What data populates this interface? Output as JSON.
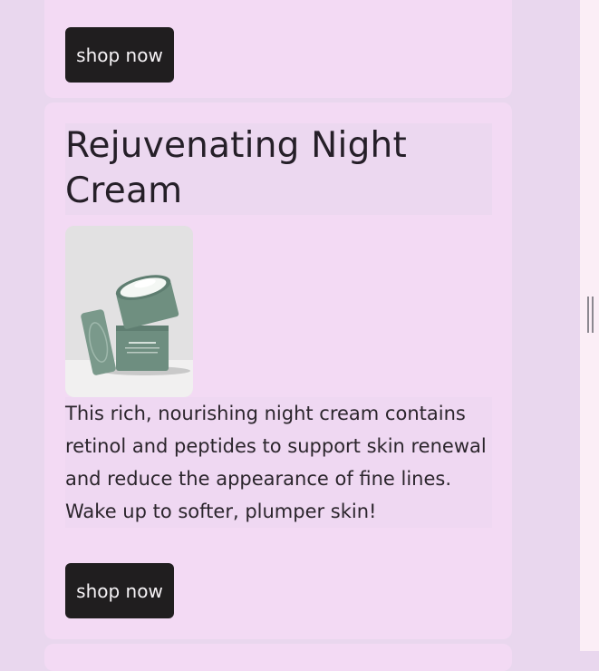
{
  "previous_card": {
    "button_label": "shop now"
  },
  "product": {
    "title": "Rejuvenating Night Cream",
    "image_alt": "Rejuvenating Night Cream jar",
    "description": "This rich, nourishing night cream contains retinol and peptides to support skin renewal and reduce the appearance of fine lines. Wake up to softer, plumper skin!",
    "button_label": "shop now"
  },
  "colors": {
    "page_background": "#e9d7ee",
    "card_background": "#f3daf4",
    "button_background": "#201e1f",
    "button_text": "#f6f3f6",
    "jar_color": "#6f8f80"
  }
}
